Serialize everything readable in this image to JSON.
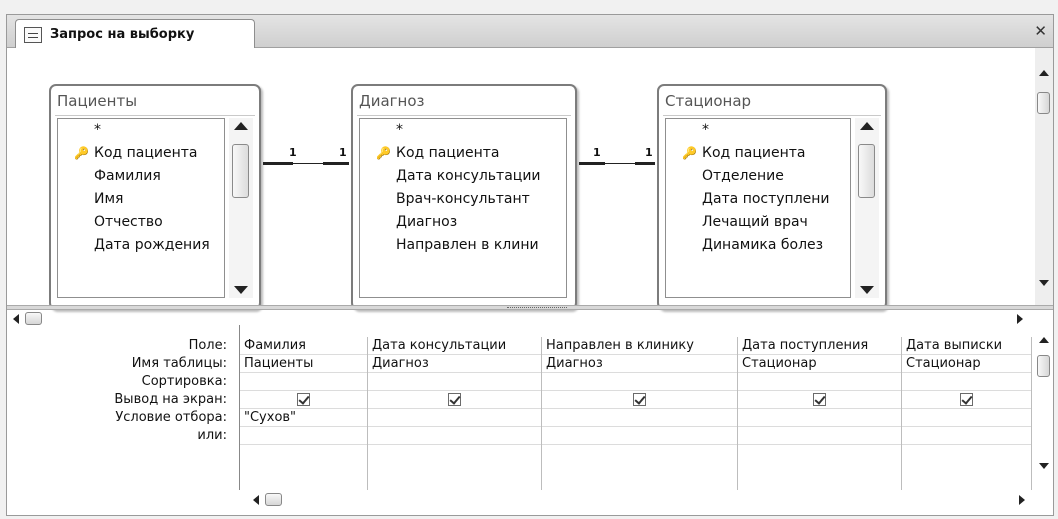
{
  "window": {
    "tab_title": "Запрос на выборку",
    "close_icon": "close-icon",
    "query_icon": "query-design-icon"
  },
  "tables": [
    {
      "title": "Пациенты",
      "fields": [
        {
          "name": "*",
          "key": false
        },
        {
          "name": "Код пациента",
          "key": true
        },
        {
          "name": "Фамилия",
          "key": false
        },
        {
          "name": "Имя",
          "key": false
        },
        {
          "name": "Отчество",
          "key": false
        },
        {
          "name": "Дата рождения",
          "key": false
        }
      ]
    },
    {
      "title": "Диагноз",
      "fields": [
        {
          "name": "*",
          "key": false
        },
        {
          "name": "Код пациента",
          "key": true
        },
        {
          "name": "Дата консультации",
          "key": false
        },
        {
          "name": "Врач-консультант",
          "key": false
        },
        {
          "name": "Диагноз",
          "key": false
        },
        {
          "name": "Направлен в клини",
          "key": false
        }
      ]
    },
    {
      "title": "Стационар",
      "fields": [
        {
          "name": "*",
          "key": false
        },
        {
          "name": "Код пациента",
          "key": true
        },
        {
          "name": "Отделение",
          "key": false
        },
        {
          "name": "Дата поступлени",
          "key": false
        },
        {
          "name": "Лечащий врач",
          "key": false
        },
        {
          "name": "Динамика болез",
          "key": false
        }
      ]
    }
  ],
  "relationships": [
    {
      "from_label": "1",
      "to_label": "1"
    },
    {
      "from_label": "1",
      "to_label": "1"
    }
  ],
  "grid": {
    "row_labels": [
      "Поле:",
      "Имя таблицы:",
      "Сортировка:",
      "Вывод на экран:",
      "Условие отбора:",
      "или:"
    ],
    "columns": [
      {
        "field": "Фамилия",
        "table": "Пациенты",
        "sort": "",
        "show": true,
        "criteria": "\"Сухов\"",
        "or": ""
      },
      {
        "field": "Дата консультации",
        "table": "Диагноз",
        "sort": "",
        "show": true,
        "criteria": "",
        "or": ""
      },
      {
        "field": "Направлен в клинику",
        "table": "Диагноз",
        "sort": "",
        "show": true,
        "criteria": "",
        "or": ""
      },
      {
        "field": "Дата поступления",
        "table": "Стационар",
        "sort": "",
        "show": true,
        "criteria": "",
        "or": ""
      },
      {
        "field": "Дата выписки",
        "table": "Стационар",
        "sort": "",
        "show": true,
        "criteria": "",
        "or": ""
      }
    ]
  }
}
